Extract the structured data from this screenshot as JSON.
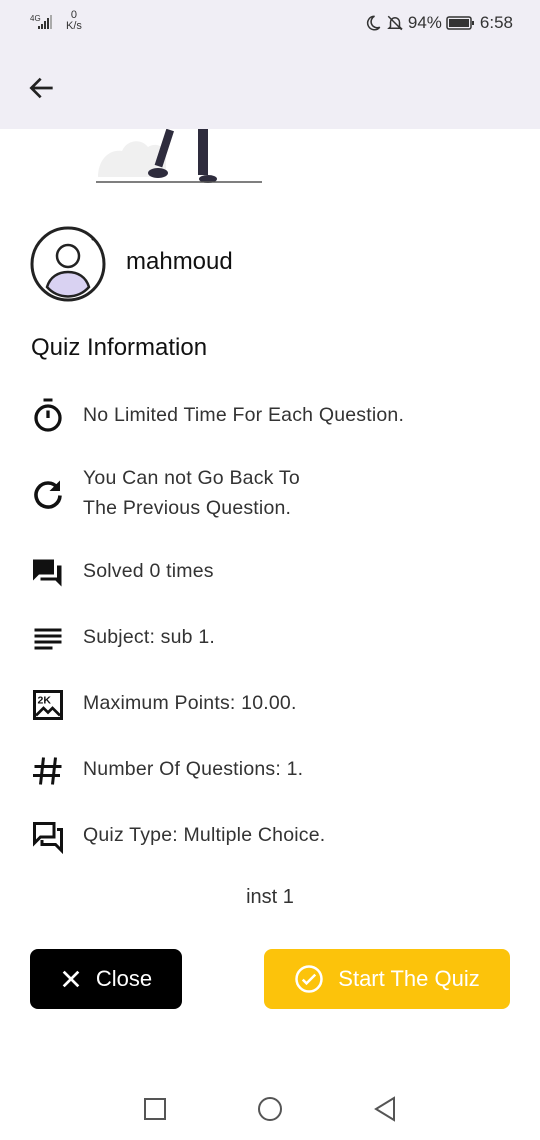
{
  "status": {
    "network": "4G",
    "speed_value": "0",
    "speed_unit": "K/s",
    "battery": "94%",
    "time": "6:58"
  },
  "profile": {
    "name": "mahmoud"
  },
  "quiz": {
    "section_title": "Quiz Information",
    "items": [
      {
        "icon": "timer-icon",
        "text": "No Limited Time For Each Question."
      },
      {
        "icon": "refresh-icon",
        "line1": "You Can not Go Back To",
        "line2": "The Previous Question."
      },
      {
        "icon": "chat-icon",
        "text": "Solved 0 times"
      },
      {
        "icon": "subject-lines-icon",
        "text": "Subject: sub 1."
      },
      {
        "icon": "points-icon",
        "text": "Maximum Points: 10.00."
      },
      {
        "icon": "hash-icon",
        "text": "Number Of Questions: 1."
      },
      {
        "icon": "forum-icon",
        "text": "Quiz Type: Multiple Choice."
      }
    ],
    "instructor": "inst 1"
  },
  "buttons": {
    "close_label": "Close",
    "start_label": "Start The Quiz"
  },
  "colors": {
    "appbar": "#f0eef5",
    "start_button": "#fcc30b",
    "close_button": "#000000",
    "avatar_fill": "#d9d2f2"
  }
}
